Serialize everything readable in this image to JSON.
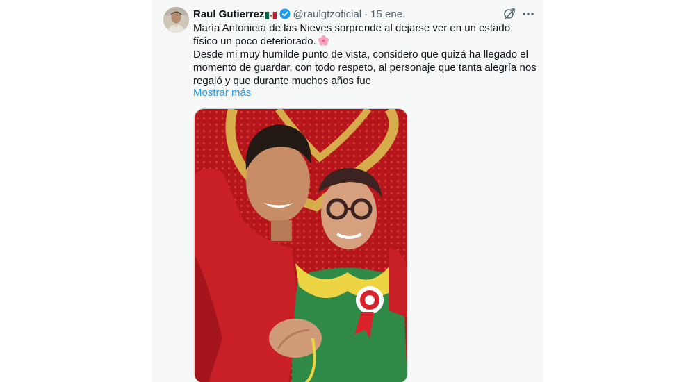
{
  "tweet": {
    "display_name": "Raul Gutierrez",
    "handle": "@raulgtzoficial",
    "separator": "·",
    "date": "15 ene.",
    "text_line1": "María Antonieta de las Nieves sorprende al dejarse ver en un estado físico un poco deteriorado.",
    "text_line2": "Desde mi muy humilde punto de vista, considero que quizá ha llegado el momento de guardar, con todo respeto, al personaje que tanta alegría nos regaló y que durante muchos años fue",
    "show_more": "Mostrar más"
  },
  "icons": {
    "flag": "mexico-flag-icon",
    "verified": "verified-badge-icon",
    "grok": "grok-icon",
    "more": "more-options-icon",
    "emoji": "cherry-blossom-icon"
  },
  "colors": {
    "link": "#1d9bf0",
    "verified": "#1d9bf0",
    "text": "#0f1419",
    "muted": "#536471",
    "card_bg": "#f7f9f9"
  }
}
